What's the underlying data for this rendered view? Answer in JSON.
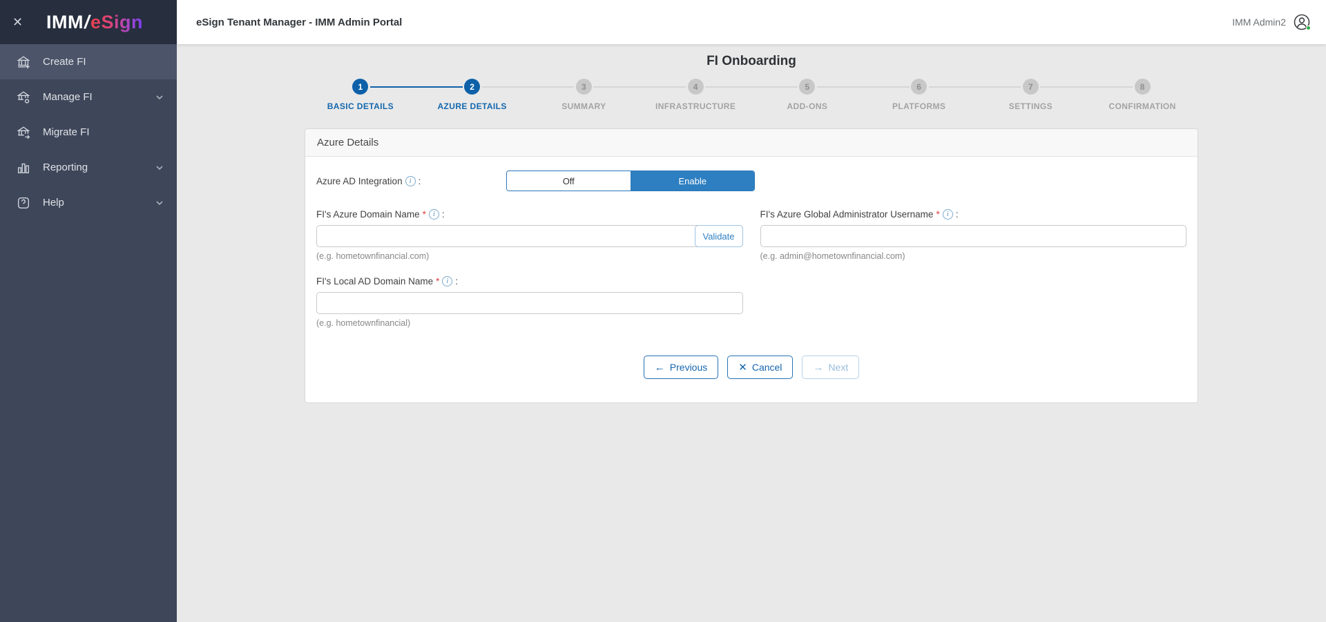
{
  "sidebar": {
    "close_icon": "✕",
    "logo": {
      "imm": "IMM",
      "slash": "/",
      "esign": "eSign"
    },
    "items": [
      {
        "label": "Create FI",
        "icon": "bank-plus-icon",
        "active": true,
        "chevron": false
      },
      {
        "label": "Manage FI",
        "icon": "bank-gear-icon",
        "active": false,
        "chevron": true
      },
      {
        "label": "Migrate FI",
        "icon": "bank-arrow-icon",
        "active": false,
        "chevron": false
      },
      {
        "label": "Reporting",
        "icon": "bar-chart-icon",
        "active": false,
        "chevron": true
      },
      {
        "label": "Help",
        "icon": "question-icon",
        "active": false,
        "chevron": true
      }
    ]
  },
  "topbar": {
    "title": "eSign Tenant Manager - IMM Admin Portal",
    "user_name": "IMM Admin2",
    "user_status_color": "#2eae4f"
  },
  "page": {
    "title": "FI Onboarding"
  },
  "stepper": {
    "current_step": 2,
    "steps": [
      {
        "num": "1",
        "label": "BASIC DETAILS",
        "state": "done"
      },
      {
        "num": "2",
        "label": "AZURE DETAILS",
        "state": "active"
      },
      {
        "num": "3",
        "label": "SUMMARY",
        "state": "todo"
      },
      {
        "num": "4",
        "label": "INFRASTRUCTURE",
        "state": "todo"
      },
      {
        "num": "5",
        "label": "ADD-ONS",
        "state": "todo"
      },
      {
        "num": "6",
        "label": "PLATFORMS",
        "state": "todo"
      },
      {
        "num": "7",
        "label": "SETTINGS",
        "state": "todo"
      },
      {
        "num": "8",
        "label": "CONFIRMATION",
        "state": "todo"
      }
    ]
  },
  "form": {
    "card_title": "Azure Details",
    "info_icon": "i",
    "required_mark": "*",
    "colon": ":",
    "toggle": {
      "label": "Azure AD Integration",
      "options": [
        {
          "label": "Off",
          "selected": false
        },
        {
          "label": "Enable",
          "selected": true
        }
      ]
    },
    "fields": {
      "azure_domain": {
        "label": "FI's Azure Domain Name",
        "value": "",
        "hint": "(e.g. hometownfinancial.com)",
        "button_label": "Validate"
      },
      "global_admin": {
        "label": "FI's Azure Global Administrator Username",
        "value": "",
        "hint": "(e.g. admin@hometownfinancial.com)"
      },
      "local_ad": {
        "label": "FI's Local AD Domain Name",
        "value": "",
        "hint": "(e.g. hometownfinancial)"
      }
    },
    "buttons": {
      "previous": {
        "icon": "←",
        "label": "Previous"
      },
      "cancel": {
        "icon": "✕",
        "label": "Cancel"
      },
      "next": {
        "icon": "→",
        "label": "Next",
        "disabled": true
      }
    }
  },
  "colors": {
    "primary_blue": "#0e60a8",
    "toggle_blue": "#2e7fc1",
    "sidebar_bg": "#3e4759",
    "content_bg": "#e9e9e9"
  }
}
